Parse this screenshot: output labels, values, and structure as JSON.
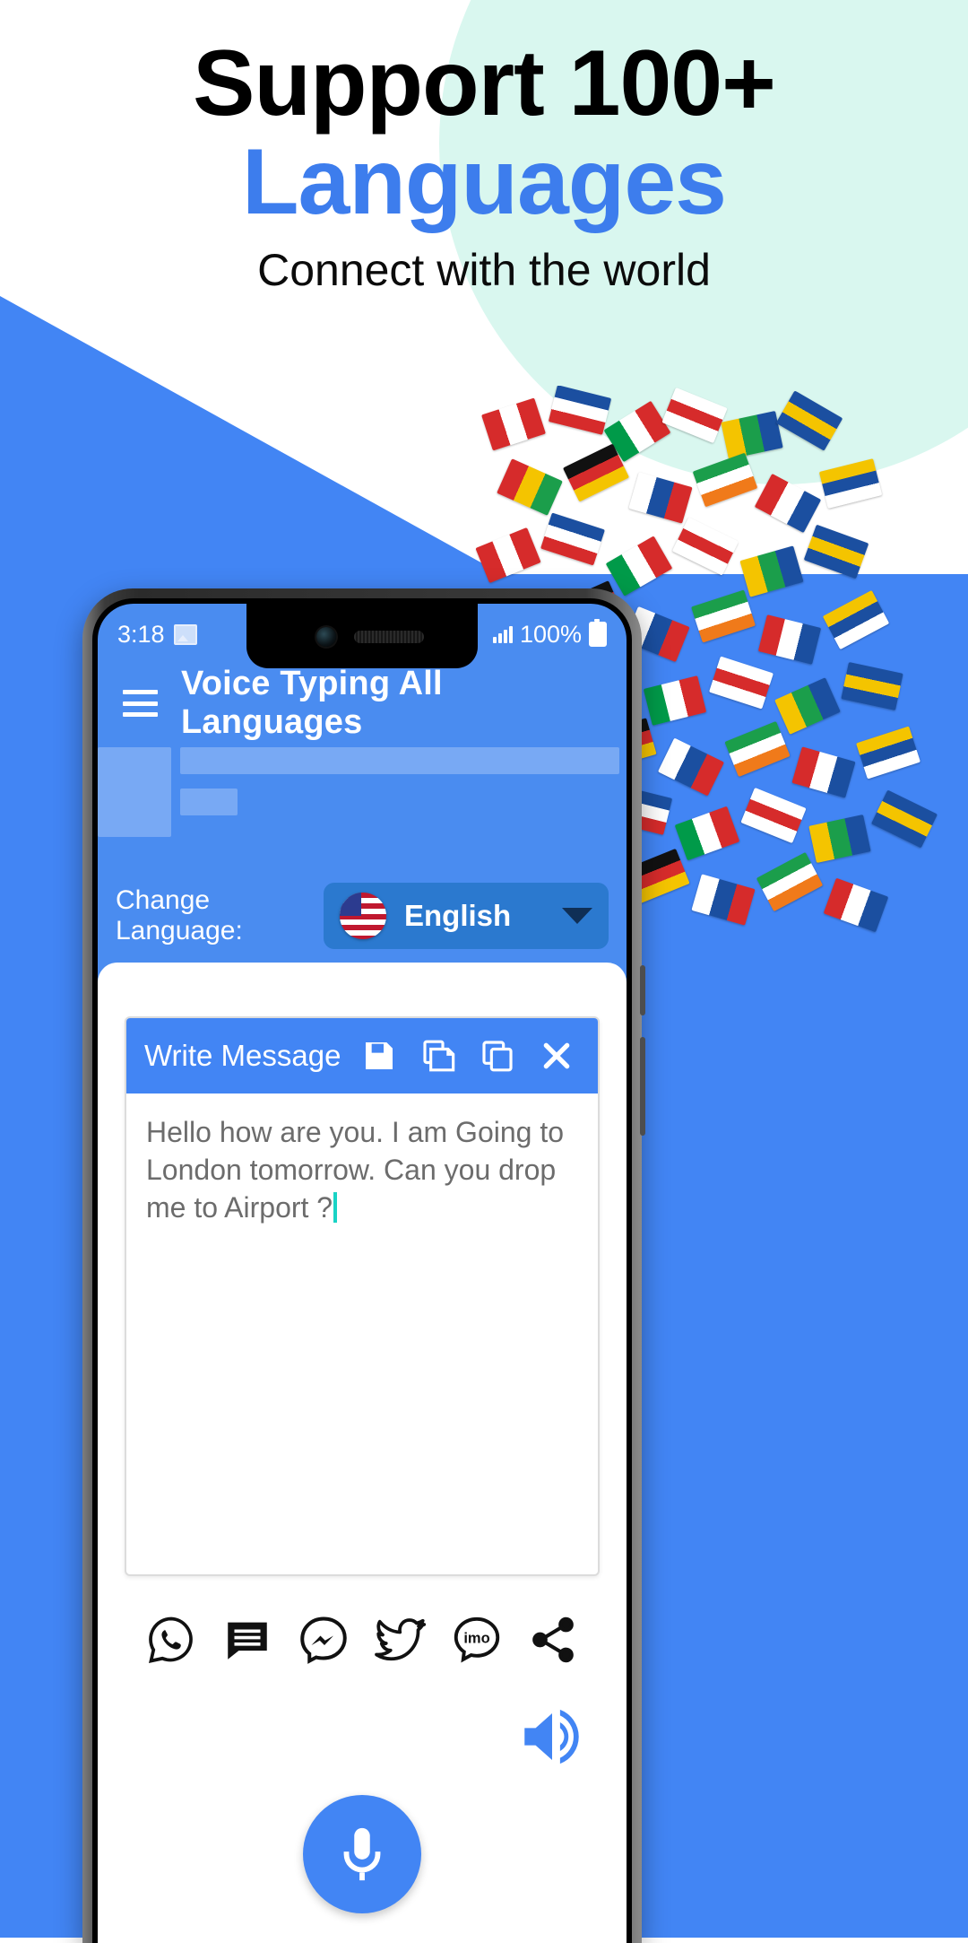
{
  "promo": {
    "title_line1": "Support 100+",
    "title_line2": "Languages",
    "subtitle": "Connect with the world",
    "title_color": "#000000",
    "accent_color": "#3d7ded",
    "background_blue": "#4285f4",
    "background_mint": "#d9f7ef"
  },
  "phone": {
    "statusbar": {
      "time": "3:18",
      "image_icon": "image-icon",
      "signal_icon": "signal-bars-icon",
      "battery_percent": "100%",
      "battery_icon": "battery-icon"
    },
    "appbar": {
      "menu_icon": "hamburger-menu-icon",
      "title": "Voice Typing All Languages"
    },
    "language_row": {
      "label": "Change Language:",
      "flag_icon": "us-flag-icon",
      "selected_language": "English",
      "caret_icon": "chevron-down-icon"
    },
    "message_card": {
      "header_title": "Write Message",
      "actions": [
        {
          "name": "save-icon",
          "label": "Save"
        },
        {
          "name": "paste-icon",
          "label": "Paste"
        },
        {
          "name": "copy-icon",
          "label": "Copy"
        },
        {
          "name": "close-icon",
          "label": "Close"
        }
      ],
      "text": "Hello how are you. I am Going to London tomorrow. Can you drop me to Airport ?",
      "caret_color": "#19d3c5",
      "text_color": "#6c6c6c"
    },
    "share_icons": [
      {
        "name": "whatsapp-icon",
        "label": "WhatsApp"
      },
      {
        "name": "sms-icon",
        "label": "SMS"
      },
      {
        "name": "messenger-icon",
        "label": "Messenger"
      },
      {
        "name": "twitter-icon",
        "label": "Twitter"
      },
      {
        "name": "imo-icon",
        "label": "imo"
      },
      {
        "name": "share-icon",
        "label": "Share"
      }
    ],
    "bottom": {
      "speaker_icon": "speaker-icon",
      "mic_icon": "microphone-icon"
    },
    "accent_color": "#4285f4",
    "select_bg": "#2b79cf"
  }
}
